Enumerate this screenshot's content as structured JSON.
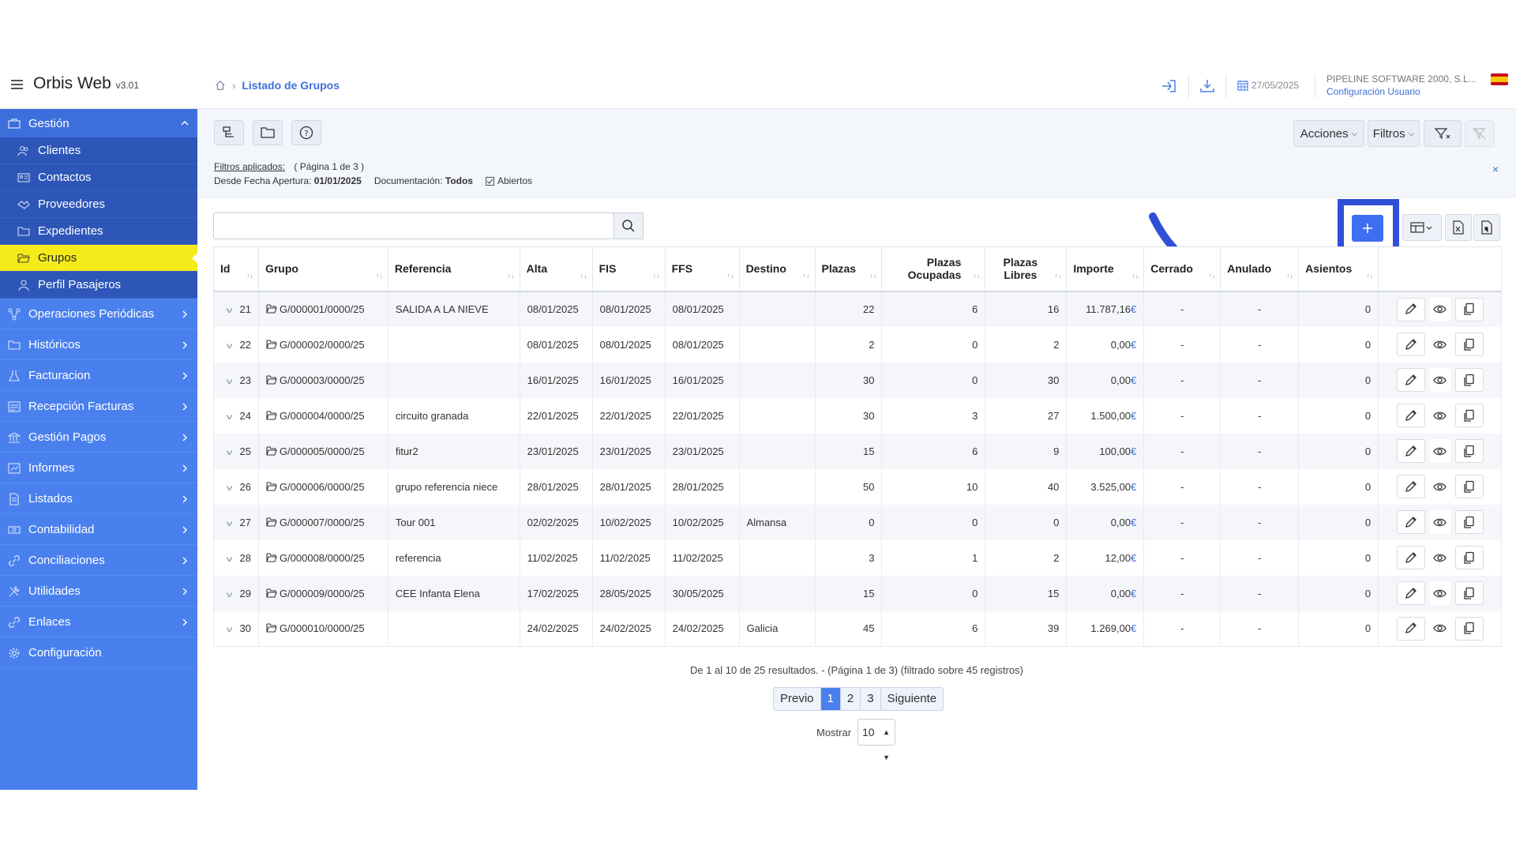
{
  "header": {
    "brand": "Orbis Web",
    "version": "v3.01",
    "breadcrumb_current": "Listado de Grupos",
    "date": "27/05/2025",
    "company": "PIPELINE SOFTWARE 2000, S.L...",
    "config_link": "Configuración Usuario"
  },
  "sidebar": {
    "section": "Gestión",
    "sub_items": [
      "Clientes",
      "Contactos",
      "Proveedores",
      "Expedientes",
      "Grupos",
      "Perfil Pasajeros"
    ],
    "active": "Grupos",
    "main_items": [
      "Operaciones Periódicas",
      "Históricos",
      "Facturacion",
      "Recepción Facturas",
      "Gestión Pagos",
      "Informes",
      "Listados",
      "Contabilidad",
      "Conciliaciones",
      "Utilidades",
      "Enlaces",
      "Configuración"
    ]
  },
  "toolbar": {
    "acciones": "Acciones",
    "filtros": "Filtros"
  },
  "filters": {
    "label": "Filtros aplicados:",
    "page_info": "( Página 1 de 3 )",
    "fecha_label": "Desde Fecha Apertura:",
    "fecha_value": "01/01/2025",
    "doc_label": "Documentación:",
    "doc_value": "Todos",
    "abiertos": "Abiertos",
    "close": "×"
  },
  "search": {
    "placeholder": ""
  },
  "table": {
    "columns": [
      "Id",
      "Grupo",
      "Referencia",
      "Alta",
      "FIS",
      "FFS",
      "Destino",
      "Plazas",
      "Plazas Ocupadas",
      "Plazas Libres",
      "Importe",
      "Cerrado",
      "Anulado",
      "Asientos"
    ],
    "currency": "€",
    "rows": [
      {
        "id": "21",
        "grupo": "G/000001/0000/25",
        "ref": "SALIDA A LA NIEVE",
        "alta": "08/01/2025",
        "fis": "08/01/2025",
        "ffs": "08/01/2025",
        "destino": "",
        "plazas": "22",
        "ocupadas": "6",
        "libres": "16",
        "importe": "11.787,16",
        "cerrado": "-",
        "anulado": "-",
        "asientos": "0"
      },
      {
        "id": "22",
        "grupo": "G/000002/0000/25",
        "ref": "",
        "alta": "08/01/2025",
        "fis": "08/01/2025",
        "ffs": "08/01/2025",
        "destino": "",
        "plazas": "2",
        "ocupadas": "0",
        "libres": "2",
        "importe": "0,00",
        "cerrado": "-",
        "anulado": "-",
        "asientos": "0"
      },
      {
        "id": "23",
        "grupo": "G/000003/0000/25",
        "ref": "",
        "alta": "16/01/2025",
        "fis": "16/01/2025",
        "ffs": "16/01/2025",
        "destino": "",
        "plazas": "30",
        "ocupadas": "0",
        "libres": "30",
        "importe": "0,00",
        "cerrado": "-",
        "anulado": "-",
        "asientos": "0"
      },
      {
        "id": "24",
        "grupo": "G/000004/0000/25",
        "ref": "circuito granada",
        "alta": "22/01/2025",
        "fis": "22/01/2025",
        "ffs": "22/01/2025",
        "destino": "",
        "plazas": "30",
        "ocupadas": "3",
        "libres": "27",
        "importe": "1.500,00",
        "cerrado": "-",
        "anulado": "-",
        "asientos": "0"
      },
      {
        "id": "25",
        "grupo": "G/000005/0000/25",
        "ref": "fitur2",
        "alta": "23/01/2025",
        "fis": "23/01/2025",
        "ffs": "23/01/2025",
        "destino": "",
        "plazas": "15",
        "ocupadas": "6",
        "libres": "9",
        "importe": "100,00",
        "cerrado": "-",
        "anulado": "-",
        "asientos": "0"
      },
      {
        "id": "26",
        "grupo": "G/000006/0000/25",
        "ref": "grupo referencia niece",
        "alta": "28/01/2025",
        "fis": "28/01/2025",
        "ffs": "28/01/2025",
        "destino": "",
        "plazas": "50",
        "ocupadas": "10",
        "libres": "40",
        "importe": "3.525,00",
        "cerrado": "-",
        "anulado": "-",
        "asientos": "0"
      },
      {
        "id": "27",
        "grupo": "G/000007/0000/25",
        "ref": "Tour 001",
        "alta": "02/02/2025",
        "fis": "10/02/2025",
        "ffs": "10/02/2025",
        "destino": "Almansa",
        "plazas": "0",
        "ocupadas": "0",
        "libres": "0",
        "importe": "0,00",
        "cerrado": "-",
        "anulado": "-",
        "asientos": "0"
      },
      {
        "id": "28",
        "grupo": "G/000008/0000/25",
        "ref": "referencia",
        "alta": "11/02/2025",
        "fis": "11/02/2025",
        "ffs": "11/02/2025",
        "destino": "",
        "plazas": "3",
        "ocupadas": "1",
        "libres": "2",
        "importe": "12,00",
        "cerrado": "-",
        "anulado": "-",
        "asientos": "0"
      },
      {
        "id": "29",
        "grupo": "G/000009/0000/25",
        "ref": "CEE Infanta Elena",
        "alta": "17/02/2025",
        "fis": "28/05/2025",
        "ffs": "30/05/2025",
        "destino": "",
        "plazas": "15",
        "ocupadas": "0",
        "libres": "15",
        "importe": "0,00",
        "cerrado": "-",
        "anulado": "-",
        "asientos": "0"
      },
      {
        "id": "30",
        "grupo": "G/000010/0000/25",
        "ref": "",
        "alta": "24/02/2025",
        "fis": "24/02/2025",
        "ffs": "24/02/2025",
        "destino": "Galicia",
        "plazas": "45",
        "ocupadas": "6",
        "libres": "39",
        "importe": "1.269,00",
        "cerrado": "-",
        "anulado": "-",
        "asientos": "0"
      }
    ]
  },
  "pagination": {
    "info": "De 1 al 10 de 25 resultados. - (Página 1 de 3) (filtrado sobre 45 registros)",
    "prev": "Previo",
    "pages": [
      "1",
      "2",
      "3"
    ],
    "next": "Siguiente",
    "show_label": "Mostrar",
    "show_value": "10"
  },
  "colors": {
    "accent": "#4a80ee",
    "active": "#f5eb1b",
    "highlight": "#2f4fd8"
  }
}
